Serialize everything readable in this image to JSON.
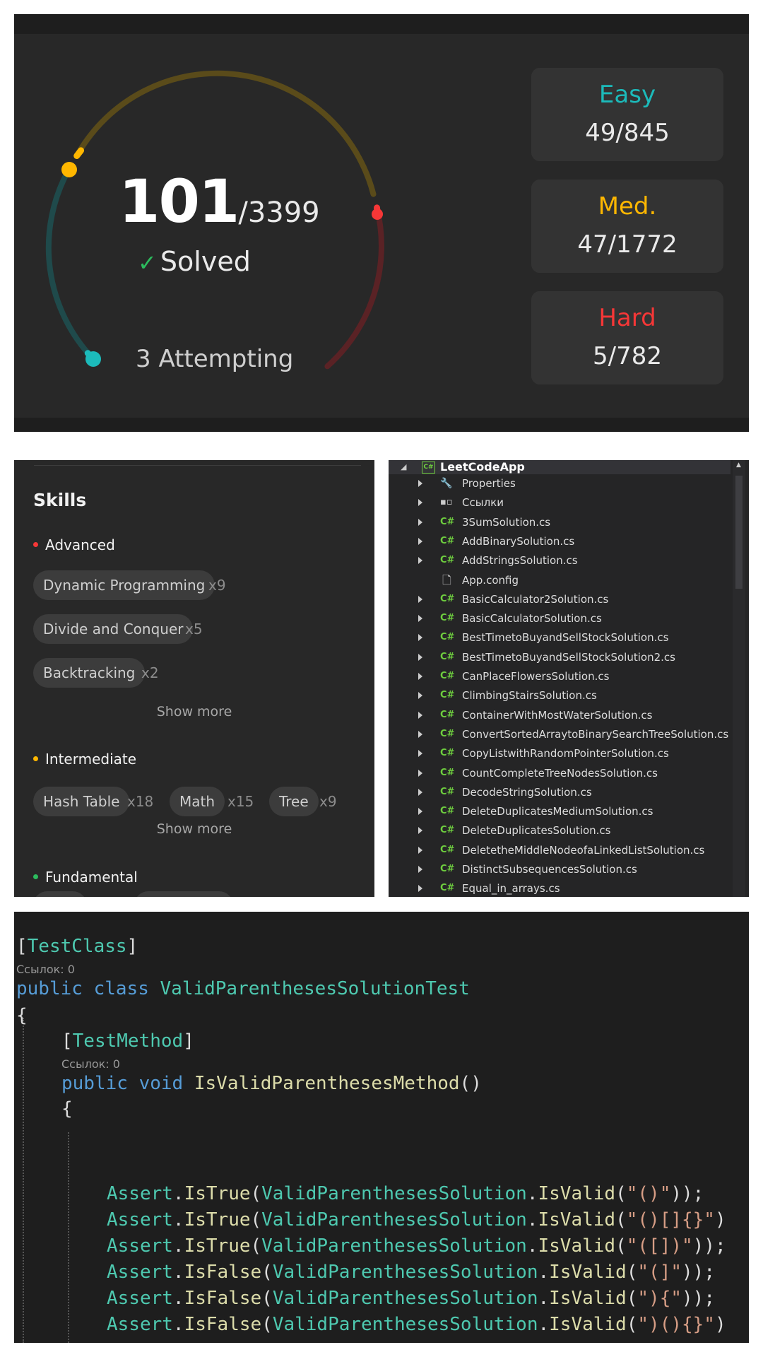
{
  "progress": {
    "solved": "101",
    "total": "/3399",
    "solved_label": "Solved",
    "attempting": "3 Attempting",
    "difficulties": [
      {
        "label": "Easy",
        "value": "49/845",
        "color": "#1cbaba"
      },
      {
        "label": "Med.",
        "value": "47/1772",
        "color": "#ffb700"
      },
      {
        "label": "Hard",
        "value": "5/782",
        "color": "#f63737"
      }
    ]
  },
  "skills": {
    "title": "Skills",
    "show_more": "Show more",
    "advanced": {
      "label": "Advanced",
      "color": "#f63737",
      "chips": [
        {
          "name": "Dynamic Programming",
          "count": "x9"
        },
        {
          "name": "Divide and Conquer",
          "count": "x5"
        },
        {
          "name": "Backtracking",
          "count": "x2"
        }
      ]
    },
    "intermediate": {
      "label": "Intermediate",
      "color": "#ffb700",
      "chips": [
        {
          "name": "Hash Table",
          "count": "x18"
        },
        {
          "name": "Math",
          "count": "x15"
        },
        {
          "name": "Tree",
          "count": "x9"
        }
      ]
    },
    "fundamental": {
      "label": "Fundamental",
      "color": "#2cbb5d"
    }
  },
  "explorer": {
    "project": "LeetCodeApp",
    "project_icon": "C#",
    "items": [
      {
        "name": "Properties",
        "icon": "wrench-icon",
        "expandable": true
      },
      {
        "name": "Ссылки",
        "icon": "references-icon",
        "expandable": true
      },
      {
        "name": "3SumSolution.cs",
        "icon": "csharp-file-icon",
        "expandable": true
      },
      {
        "name": "AddBinarySolution.cs",
        "icon": "csharp-file-icon",
        "expandable": true
      },
      {
        "name": "AddStringsSolution.cs",
        "icon": "csharp-file-icon",
        "expandable": true
      },
      {
        "name": "App.config",
        "icon": "config-file-icon",
        "expandable": false
      },
      {
        "name": "BasicCalculator2Solution.cs",
        "icon": "csharp-file-icon",
        "expandable": true
      },
      {
        "name": "BasicCalculatorSolution.cs",
        "icon": "csharp-file-icon",
        "expandable": true
      },
      {
        "name": "BestTimetoBuyandSellStockSolution.cs",
        "icon": "csharp-file-icon",
        "expandable": true
      },
      {
        "name": "BestTimetoBuyandSellStockSolution2.cs",
        "icon": "csharp-file-icon",
        "expandable": true
      },
      {
        "name": "CanPlaceFlowersSolution.cs",
        "icon": "csharp-file-icon",
        "expandable": true
      },
      {
        "name": "ClimbingStairsSolution.cs",
        "icon": "csharp-file-icon",
        "expandable": true
      },
      {
        "name": "ContainerWithMostWaterSolution.cs",
        "icon": "csharp-file-icon",
        "expandable": true
      },
      {
        "name": "ConvertSortedArraytoBinarySearchTreeSolution.cs",
        "icon": "csharp-file-icon",
        "expandable": true
      },
      {
        "name": "CopyListwithRandomPointerSolution.cs",
        "icon": "csharp-file-icon",
        "expandable": true
      },
      {
        "name": "CountCompleteTreeNodesSolution.cs",
        "icon": "csharp-file-icon",
        "expandable": true
      },
      {
        "name": "DecodeStringSolution.cs",
        "icon": "csharp-file-icon",
        "expandable": true
      },
      {
        "name": "DeleteDuplicatesMediumSolution.cs",
        "icon": "csharp-file-icon",
        "expandable": true
      },
      {
        "name": "DeleteDuplicatesSolution.cs",
        "icon": "csharp-file-icon",
        "expandable": true
      },
      {
        "name": "DeletetheMiddleNodeofaLinkedListSolution.cs",
        "icon": "csharp-file-icon",
        "expandable": true
      },
      {
        "name": "DistinctSubsequencesSolution.cs",
        "icon": "csharp-file-icon",
        "expandable": true
      },
      {
        "name": "Equal_in_arrays.cs",
        "icon": "csharp-file-icon",
        "expandable": true
      }
    ]
  },
  "code": {
    "refs": "Ссылок: 0",
    "attr_class": "TestClass",
    "kw_public": "public",
    "kw_class": "class",
    "class_name": "ValidParenthesesSolutionTest",
    "brace_open": "{",
    "attr_method": "TestMethod",
    "kw_void": "void",
    "method_name": "IsValidParenthesesMethod",
    "parens": "()",
    "assert_obj": "Assert",
    "solution_cls": "ValidParenthesesSolution",
    "is_valid": "IsValid",
    "asserts": [
      {
        "method": "IsTrue",
        "arg": "\"()\"",
        "tail": "));"
      },
      {
        "method": "IsTrue",
        "arg": "\"()[]{}\"",
        "tail": ")"
      },
      {
        "method": "IsTrue",
        "arg": "\"([])\"",
        "tail": "));"
      },
      {
        "method": "IsFalse",
        "arg": "\"(]\"",
        "tail": "));"
      },
      {
        "method": "IsFalse",
        "arg": "\"){\"",
        "tail": "));"
      },
      {
        "method": "IsFalse",
        "arg": "\")(){}\"",
        "tail": ")"
      }
    ],
    "colors": {
      "keyword": "#569cd6",
      "type": "#4ec9b0",
      "method": "#dcdcaa",
      "string": "#d69d85",
      "text": "#dcdcdc"
    }
  }
}
